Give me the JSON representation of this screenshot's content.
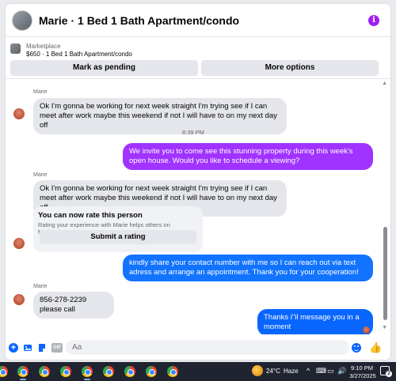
{
  "header": {
    "title": "Marie · 1 Bed 1 Bath Apartment/condo",
    "info_icon": "info-icon"
  },
  "listing": {
    "label": "Marketplace",
    "title": "$650 · 1 Bed 1 Bath Apartment/condo",
    "mark_pending": "Mark as pending",
    "more_options": "More options"
  },
  "messages": [
    {
      "sender": "Marie",
      "direction": "in",
      "text": "Ok I'm gonna be working for next week straight I'm trying see if I can meet after work maybe this weekend if not I will have to on my next day off"
    },
    {
      "timestamp": "8:39 PM"
    },
    {
      "direction": "out",
      "color": "#a033ff",
      "text": "We invite you to come see this stunning property during this week's open house. Would you like to schedule a viewing?"
    },
    {
      "sender": "Marie",
      "direction": "in",
      "text": "Ok I'm gonna be working for next week straight I'm trying see if I can meet after work maybe this weekend if not I will have to on my next day off"
    },
    {
      "direction": "out",
      "color": "#1273ff",
      "text": "kindly share your contact number with me so I can reach out via text adress and arrange an appointment. Thank you for your cooperation!"
    },
    {
      "sender": "Marie",
      "direction": "in",
      "text": "856-278-2239 please call"
    },
    {
      "direction": "out",
      "color": "#0866ff",
      "text": "Thanks i\"il message you in a moment"
    }
  ],
  "rating": {
    "title": "You can now rate this person",
    "subtitle": "Rating your experience with Marie helps others on Marketplace.",
    "button": "Submit a rating"
  },
  "composer": {
    "placeholder": "Aa"
  },
  "taskbar": {
    "temperature": "24°C",
    "condition": "Haze",
    "time": "9:10 PM",
    "date": "3/27/2025",
    "notifications": "2"
  },
  "colors": {
    "accent": "#0866ff",
    "purple_bubble": "#a033ff"
  }
}
